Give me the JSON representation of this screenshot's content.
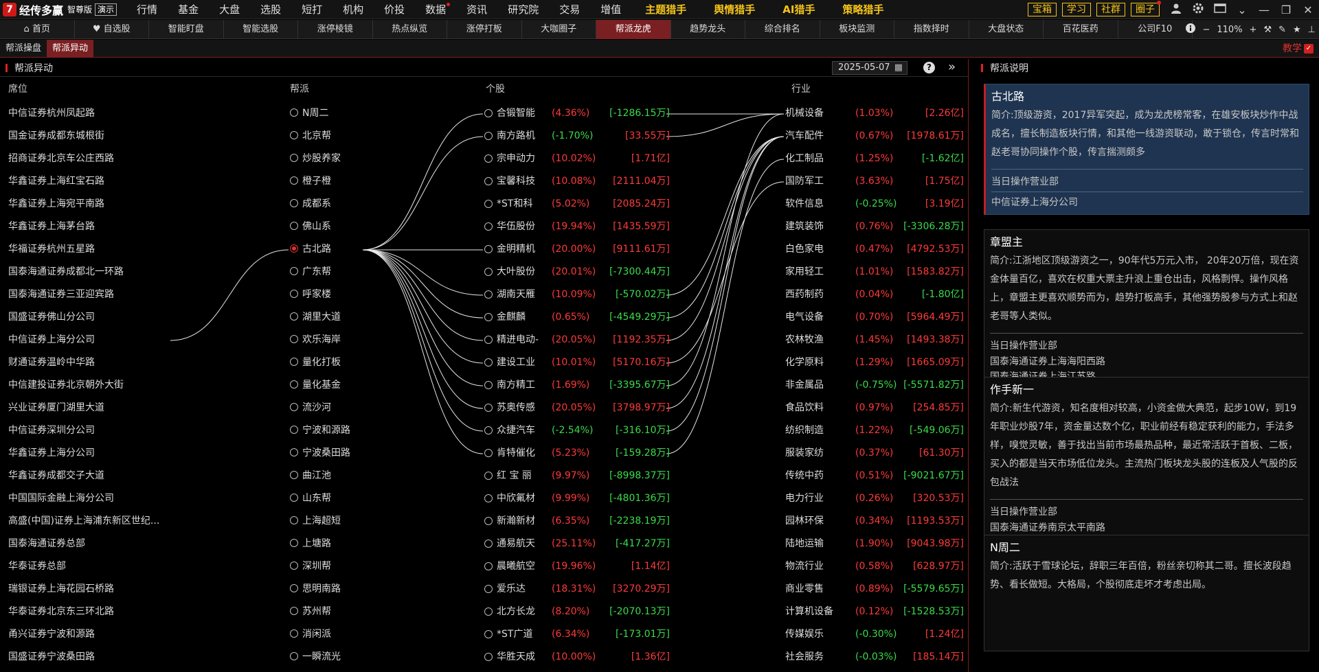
{
  "app": {
    "logo_mark": "7",
    "name": "经传多赢",
    "edition": "智尊版",
    "demo_label": "演示"
  },
  "top_menu": [
    {
      "label": "行情",
      "dot": false,
      "hl": false
    },
    {
      "label": "基金",
      "dot": false,
      "hl": false
    },
    {
      "label": "大盘",
      "dot": false,
      "hl": false
    },
    {
      "label": "选股",
      "dot": false,
      "hl": false
    },
    {
      "label": "短打",
      "dot": false,
      "hl": false
    },
    {
      "label": "机构",
      "dot": false,
      "hl": false
    },
    {
      "label": "价投",
      "dot": false,
      "hl": false
    },
    {
      "label": "数据",
      "dot": true,
      "hl": false
    },
    {
      "label": "资讯",
      "dot": false,
      "hl": false
    },
    {
      "label": "研究院",
      "dot": false,
      "hl": false
    },
    {
      "label": "交易",
      "dot": false,
      "hl": false
    },
    {
      "label": "增值",
      "dot": false,
      "hl": false
    },
    {
      "label": "主题猎手",
      "dot": false,
      "hl": true
    },
    {
      "label": "舆情猎手",
      "dot": false,
      "hl": true
    },
    {
      "label": "AI猎手",
      "dot": false,
      "hl": true
    },
    {
      "label": "策略猎手",
      "dot": false,
      "hl": true
    }
  ],
  "right_buttons": [
    {
      "label": "宝箱",
      "dot": false
    },
    {
      "label": "学习",
      "dot": false
    },
    {
      "label": "社群",
      "dot": false
    },
    {
      "label": "圈子",
      "dot": true
    }
  ],
  "tabs2": [
    "首页",
    "自选股",
    "智能盯盘",
    "智能选股",
    "涨停棱镜",
    "热点纵览",
    "涨停打板",
    "大咖圈子",
    "帮派龙虎",
    "趋势龙头",
    "综合排名",
    "板块监测",
    "指数择时",
    "大盘状态",
    "百花医药",
    "公司F10"
  ],
  "tabs2_active": 8,
  "zoom": {
    "minus": "−",
    "value": "110%",
    "plus": "+"
  },
  "tabs3": [
    "帮派操盘",
    "帮派异动"
  ],
  "tabs3_active": 1,
  "teach_label": "教学",
  "panel": {
    "title": "帮派异动",
    "date": "2025-05-07",
    "help": "?"
  },
  "columns": {
    "seat": "席位",
    "gang": "帮派",
    "stock": "个股",
    "industry": "行业"
  },
  "seats": [
    "中信证券杭州凤起路",
    "国金证券成都东城根街",
    "招商证券北京车公庄西路",
    "华鑫证券上海红宝石路",
    "华鑫证券上海宛平南路",
    "华鑫证券上海茅台路",
    "华福证券杭州五星路",
    "国泰海通证券成都北一环路",
    "国泰海通证券三亚迎宾路",
    "国盛证券佛山分公司",
    "中信证券上海分公司",
    "财通证券温岭中华路",
    "中信建投证券北京朝外大街",
    "兴业证券厦门湖里大道",
    "中信证券深圳分公司",
    "华鑫证券上海分公司",
    "华鑫证券成都交子大道",
    "中国国际金融上海分公司",
    "高盛(中国)证券上海浦东新区世纪...",
    "国泰海通证券总部",
    "华泰证券总部",
    "瑞银证券上海花园石桥路",
    "华泰证券北京东三环北路",
    "甬兴证券宁波和源路",
    "国盛证券宁波桑田路"
  ],
  "gangs": [
    "N周二",
    "北京帮",
    "炒股养家",
    "橙子橙",
    "成都系",
    "佛山系",
    "古北路",
    "广东帮",
    "呼家楼",
    "湖里大道",
    "欢乐海岸",
    "量化打板",
    "量化基金",
    "流沙河",
    "宁波和源路",
    "宁波桑田路",
    "曲江池",
    "山东帮",
    "上海超短",
    "上塘路",
    "深圳帮",
    "思明南路",
    "苏州帮",
    "消闲派",
    "一瞬流光"
  ],
  "gang_selected": 6,
  "stocks": [
    {
      "name": "合锻智能",
      "pct": "(4.36%)",
      "amt": "[-1286.15万]",
      "pc": "red",
      "ac": "green"
    },
    {
      "name": "南方路机",
      "pct": "(-1.70%)",
      "amt": "[33.55万]",
      "pc": "green",
      "ac": "red"
    },
    {
      "name": "宗申动力",
      "pct": "(10.02%)",
      "amt": "[1.71亿]",
      "pc": "red",
      "ac": "red"
    },
    {
      "name": "宝馨科技",
      "pct": "(10.08%)",
      "amt": "[2111.04万]",
      "pc": "red",
      "ac": "red"
    },
    {
      "name": "*ST和科",
      "pct": "(5.02%)",
      "amt": "[2085.24万]",
      "pc": "red",
      "ac": "red"
    },
    {
      "name": "华伍股份",
      "pct": "(19.94%)",
      "amt": "[1435.59万]",
      "pc": "red",
      "ac": "red"
    },
    {
      "name": "金明精机",
      "pct": "(20.00%)",
      "amt": "[9111.61万]",
      "pc": "red",
      "ac": "red"
    },
    {
      "name": "大叶股份",
      "pct": "(20.01%)",
      "amt": "[-7300.44万]",
      "pc": "red",
      "ac": "green"
    },
    {
      "name": "湖南天雁",
      "pct": "(10.09%)",
      "amt": "[-570.02万]",
      "pc": "red",
      "ac": "green"
    },
    {
      "name": "金麒麟",
      "pct": "(0.65%)",
      "amt": "[-4549.29万]",
      "pc": "red",
      "ac": "green"
    },
    {
      "name": "精进电动-",
      "pct": "(20.05%)",
      "amt": "[1192.35万]",
      "pc": "red",
      "ac": "red"
    },
    {
      "name": "建设工业",
      "pct": "(10.01%)",
      "amt": "[5170.16万]",
      "pc": "red",
      "ac": "red"
    },
    {
      "name": "南方精工",
      "pct": "(1.69%)",
      "amt": "[-3395.67万]",
      "pc": "red",
      "ac": "green"
    },
    {
      "name": "苏奥传感",
      "pct": "(20.05%)",
      "amt": "[3798.97万]",
      "pc": "red",
      "ac": "red"
    },
    {
      "name": "众捷汽车",
      "pct": "(-2.54%)",
      "amt": "[-316.10万]",
      "pc": "green",
      "ac": "green"
    },
    {
      "name": "肯特催化",
      "pct": "(5.23%)",
      "amt": "[-159.28万]",
      "pc": "red",
      "ac": "green"
    },
    {
      "name": "红 宝 丽",
      "pct": "(9.97%)",
      "amt": "[-8998.37万]",
      "pc": "red",
      "ac": "green"
    },
    {
      "name": "中欣氟材",
      "pct": "(9.99%)",
      "amt": "[-4801.36万]",
      "pc": "red",
      "ac": "green"
    },
    {
      "name": "新瀚新材",
      "pct": "(6.35%)",
      "amt": "[-2238.19万]",
      "pc": "red",
      "ac": "green"
    },
    {
      "name": "通易航天",
      "pct": "(25.11%)",
      "amt": "[-417.27万]",
      "pc": "red",
      "ac": "green"
    },
    {
      "name": "晨曦航空",
      "pct": "(19.96%)",
      "amt": "[1.14亿]",
      "pc": "red",
      "ac": "red"
    },
    {
      "name": "爱乐达",
      "pct": "(18.31%)",
      "amt": "[3270.29万]",
      "pc": "red",
      "ac": "red"
    },
    {
      "name": "北方长龙",
      "pct": "(8.20%)",
      "amt": "[-2070.13万]",
      "pc": "red",
      "ac": "green"
    },
    {
      "name": "*ST广道",
      "pct": "(6.34%)",
      "amt": "[-173.01万]",
      "pc": "red",
      "ac": "green"
    },
    {
      "name": "华胜天成",
      "pct": "(10.00%)",
      "amt": "[1.36亿]",
      "pc": "red",
      "ac": "red"
    }
  ],
  "industries": [
    {
      "name": "机械设备",
      "pct": "(1.03%)",
      "amt": "[2.26亿]",
      "pc": "red",
      "ac": "red"
    },
    {
      "name": "汽车配件",
      "pct": "(0.67%)",
      "amt": "[1978.61万]",
      "pc": "red",
      "ac": "red"
    },
    {
      "name": "化工制品",
      "pct": "(1.25%)",
      "amt": "[-1.62亿]",
      "pc": "red",
      "ac": "green"
    },
    {
      "name": "国防军工",
      "pct": "(3.63%)",
      "amt": "[1.75亿]",
      "pc": "red",
      "ac": "red"
    },
    {
      "name": "软件信息",
      "pct": "(-0.25%)",
      "amt": "[3.19亿]",
      "pc": "green",
      "ac": "red"
    },
    {
      "name": "建筑装饰",
      "pct": "(0.76%)",
      "amt": "[-3306.28万]",
      "pc": "red",
      "ac": "green"
    },
    {
      "name": "白色家电",
      "pct": "(0.47%)",
      "amt": "[4792.53万]",
      "pc": "red",
      "ac": "red"
    },
    {
      "name": "家用轻工",
      "pct": "(1.01%)",
      "amt": "[1583.82万]",
      "pc": "red",
      "ac": "red"
    },
    {
      "name": "西药制药",
      "pct": "(0.04%)",
      "amt": "[-1.80亿]",
      "pc": "red",
      "ac": "green"
    },
    {
      "name": "电气设备",
      "pct": "(0.70%)",
      "amt": "[5964.49万]",
      "pc": "red",
      "ac": "red"
    },
    {
      "name": "农林牧渔",
      "pct": "(1.45%)",
      "amt": "[1493.38万]",
      "pc": "red",
      "ac": "red"
    },
    {
      "name": "化学原料",
      "pct": "(1.29%)",
      "amt": "[1665.09万]",
      "pc": "red",
      "ac": "red"
    },
    {
      "name": "非金属品",
      "pct": "(-0.75%)",
      "amt": "[-5571.82万]",
      "pc": "green",
      "ac": "green"
    },
    {
      "name": "食品饮料",
      "pct": "(0.97%)",
      "amt": "[254.85万]",
      "pc": "red",
      "ac": "red"
    },
    {
      "name": "纺织制造",
      "pct": "(1.22%)",
      "amt": "[-549.06万]",
      "pc": "red",
      "ac": "green"
    },
    {
      "name": "服装家纺",
      "pct": "(0.37%)",
      "amt": "[61.30万]",
      "pc": "red",
      "ac": "red"
    },
    {
      "name": "传统中药",
      "pct": "(0.51%)",
      "amt": "[-9021.67万]",
      "pc": "red",
      "ac": "green"
    },
    {
      "name": "电力行业",
      "pct": "(0.26%)",
      "amt": "[320.53万]",
      "pc": "red",
      "ac": "red"
    },
    {
      "name": "园林环保",
      "pct": "(0.34%)",
      "amt": "[1193.53万]",
      "pc": "red",
      "ac": "red"
    },
    {
      "name": "陆地运输",
      "pct": "(1.90%)",
      "amt": "[9043.98万]",
      "pc": "red",
      "ac": "red"
    },
    {
      "name": "物流行业",
      "pct": "(0.58%)",
      "amt": "[628.97万]",
      "pc": "red",
      "ac": "red"
    },
    {
      "name": "商业零售",
      "pct": "(0.89%)",
      "amt": "[-5579.65万]",
      "pc": "red",
      "ac": "green"
    },
    {
      "name": "计算机设备",
      "pct": "(0.12%)",
      "amt": "[-1528.53万]",
      "pc": "red",
      "ac": "green"
    },
    {
      "name": "传媒娱乐",
      "pct": "(-0.30%)",
      "amt": "[1.24亿]",
      "pc": "green",
      "ac": "red"
    },
    {
      "name": "社会服务",
      "pct": "(-0.03%)",
      "amt": "[185.14万]",
      "pc": "green",
      "ac": "red"
    }
  ],
  "links": {
    "seat_to_gang": [
      [
        10,
        6
      ]
    ],
    "gang_to_stock": [
      [
        6,
        0
      ],
      [
        6,
        1
      ],
      [
        6,
        6
      ],
      [
        6,
        8
      ],
      [
        6,
        9
      ],
      [
        6,
        10
      ],
      [
        6,
        11
      ],
      [
        6,
        12
      ],
      [
        6,
        13
      ],
      [
        6,
        14
      ],
      [
        6,
        15
      ]
    ],
    "stock_to_industry": [
      [
        0,
        0
      ],
      [
        1,
        0
      ],
      [
        8,
        1
      ],
      [
        9,
        1
      ],
      [
        10,
        1
      ],
      [
        11,
        3
      ],
      [
        12,
        0
      ],
      [
        13,
        1
      ],
      [
        14,
        1
      ],
      [
        15,
        2
      ]
    ]
  },
  "side": {
    "title": "帮派说明",
    "cards": [
      {
        "name": "古北路",
        "intro": "简介:顶级游资，2017异军突起，成为龙虎榜常客，在雄安板块炒作中战成名，擅长制造板块行情，和其他一线游资联动，敢于锁仓，传言时常和赵老哥协同操作个股，传言揣测颇多",
        "label": "当日操作营业部",
        "depts": [
          "中信证券上海分公司"
        ],
        "active": true
      },
      {
        "name": "章盟主",
        "intro": "简介:江浙地区顶级游资之一，90年代5万元入市， 20年20万倍，现在资金体量百亿，喜欢在权重大票主升浪上重仓出击，风格剽悍。操作风格上，章盟主更喜欢顺势而为，趋势打板高手，其他强势股参与方式上和赵老哥等人类似。",
        "label": "当日操作营业部",
        "depts": [
          "国泰海通证券上海海阳西路",
          "国泰海通证券上海江苏路"
        ],
        "active": false
      },
      {
        "name": "作手新一",
        "intro": "简介:新生代游资，知名度相对较高，小资金做大典范，起步10W，到19年职业炒股7年，资金量达数个亿，职业前经有稳定获利的能力，手法多样，嗅觉灵敏，善于找出当前市场最热品种，最近常活跃于首板、二板，买入的都是当天市场低位龙头。主流热门板块龙头股的连板及人气股的反包战法",
        "label": "当日操作营业部",
        "depts": [
          "国泰海通证券南京太平南路"
        ],
        "active": false
      },
      {
        "name": "N周二",
        "intro": "简介:活跃于雪球论坛，辞职三年百倍，粉丝亲切称其二哥。擅长波段趋势、看长做短。大格局，个股彻底走坏才考虑出局。",
        "label": "",
        "depts": [],
        "active": false
      }
    ]
  },
  "colors": {
    "up": "#ff3a3a",
    "down": "#3adc4a",
    "accent": "#7a1f22",
    "hl": "#f5c518"
  }
}
